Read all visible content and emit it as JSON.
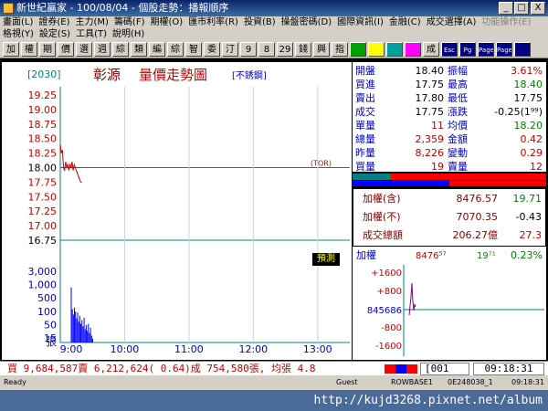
{
  "window": {
    "title": "新世紀贏家 - 100/08/04 - 個股走勢：播報順序",
    "controls": [
      "_",
      "□",
      "X"
    ]
  },
  "menu": {
    "row1": [
      "畫面(L)",
      "證券(E)",
      "主力(M)",
      "籌碼(F)",
      "期權(O)",
      "匯市利率(R)",
      "投資(B)",
      "操盤密碼(D)",
      "國際資訊(I)",
      "金融(C)",
      "成交選擇(A)",
      "功能操作(E)"
    ],
    "row1_disabled": [
      11
    ],
    "row2": [
      "格視(Y)",
      "設定(S)",
      "工具(T)",
      "說明(H)"
    ]
  },
  "toolbar": {
    "buttons": [
      "加",
      "權",
      "期",
      "價",
      "選",
      "週",
      "綜",
      "類",
      "編",
      "綜",
      "智",
      "委",
      "汀",
      "9",
      "8",
      "29",
      "錢",
      "興",
      "指",
      "",
      "",
      "",
      "",
      "成",
      "Esc",
      "Pg",
      "Page",
      "Page",
      ""
    ]
  },
  "chart": {
    "code": "[2030]",
    "name": "彰源",
    "title": "量價走勢圖",
    "note": "[不銹鋼]",
    "ref_label": "(TOR)",
    "predict_label": "預測",
    "price_ticks": [
      "19.25",
      "19.00",
      "18.75",
      "18.50",
      "18.25",
      "18.00",
      "17.75",
      "17.50",
      "17.25",
      "17.00",
      "16.75"
    ],
    "volume_ticks": [
      "3,000",
      "1,000",
      "500",
      "100",
      "50",
      "15"
    ],
    "volume_unit": "張",
    "time_ticks": [
      "9:00",
      "10:00",
      "11:00",
      "12:00",
      "13:00"
    ]
  },
  "chart_data": {
    "type": "line",
    "xlabel": "",
    "ylabel": "",
    "ylim": [
      16.75,
      19.25
    ],
    "reference_price": 18.0,
    "x": [
      "9:00",
      "9:01",
      "9:02",
      "9:03",
      "9:04",
      "9:05",
      "9:06",
      "9:07",
      "9:08",
      "9:09",
      "9:10",
      "9:11",
      "9:12",
      "9:13",
      "9:14",
      "9:15",
      "9:16",
      "9:17",
      "9:18",
      "9:19",
      "9:20"
    ],
    "series": [
      {
        "values": [
          18.4,
          18.25,
          18.3,
          18.0,
          17.95,
          18.1,
          18.0,
          18.05,
          17.95,
          18.05,
          18.0,
          18.1,
          17.95,
          18.05,
          18.0,
          17.95,
          17.9,
          17.85,
          17.8,
          17.75,
          17.75
        ]
      }
    ],
    "volume": [
      900,
      180,
      120,
      200,
      150,
      90,
      140,
      70,
      110,
      60,
      80,
      50,
      95,
      40,
      55,
      35,
      60,
      30,
      45,
      25,
      20
    ]
  },
  "quote": {
    "rows": [
      {
        "l1": "開盤",
        "v1": "18.40",
        "c1": "#000000",
        "l2": "振幅",
        "v2": "3.61%",
        "c2": "#c00000"
      },
      {
        "l1": "買進",
        "v1": "17.75",
        "c1": "#000000",
        "l2": "最高",
        "v2": "18.40",
        "c2": "#008000"
      },
      {
        "l1": "賣出",
        "v1": "17.80",
        "c1": "#000000",
        "l2": "最低",
        "v2": "17.75",
        "c2": "#000000"
      },
      {
        "l1": "成交",
        "v1": "17.75",
        "c1": "#000000",
        "l2": "漲跌",
        "v2": "-0.25(1⁹⁹)",
        "c2": "#000000"
      },
      {
        "l1": "單量",
        "v1": "11",
        "c1": "#c00000",
        "l2": "均價",
        "v2": "18.20",
        "c2": "#008000"
      },
      {
        "l1": "總量",
        "v1": "2,359",
        "c1": "#c00000",
        "l2": "金額",
        "v2": "0.42",
        "c2": "#c00000"
      },
      {
        "l1": "昨量",
        "v1": "8,226",
        "c1": "#c00000",
        "l2": "變動",
        "v2": "0.29",
        "c2": "#c00000"
      },
      {
        "l1": "買量",
        "v1": "19",
        "c1": "#c00000",
        "l2": "賣量",
        "v2": "12",
        "c2": "#c00000"
      }
    ]
  },
  "index": {
    "rows": [
      {
        "label": "加權(含)",
        "value": "8476.57",
        "change": "19.71",
        "change_color": "#008000"
      },
      {
        "label": "加權(不)",
        "value": "7070.35",
        "change": "-0.43",
        "change_color": "#000000"
      },
      {
        "label": "成交總額",
        "value": "206.27億",
        "change": "27.3",
        "change_color": "#c00000"
      }
    ]
  },
  "mini": {
    "label": "加權",
    "value": "8476⁵⁷",
    "change": "19⁷¹",
    "pct": "0.23%",
    "ticks": [
      "+1600",
      "+800",
      "845686",
      "-800",
      "-1600"
    ]
  },
  "ticker": {
    "text": "買 9,684,587賣 6,212,624( 0.64)成 754,580張, 均張 4.8",
    "code": "[001",
    "clock": "09:18:31"
  },
  "status": {
    "left": "Ready",
    "items": [
      "Guest",
      "ROWBASE1",
      "0E248038_1",
      "09:18:31"
    ]
  },
  "watermark": "http://kujd3268.pixnet.net/album",
  "colors": {
    "grid_teal": "#008080",
    "price_red": "#c00000",
    "volume_blue": "#0000ff",
    "axis_blue": "#0000c0",
    "panel_black": "#000000"
  }
}
